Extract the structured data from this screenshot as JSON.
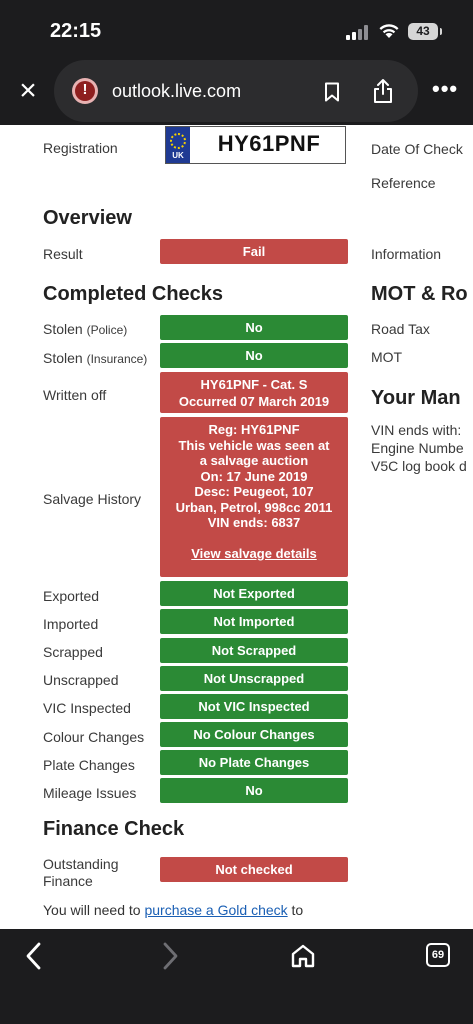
{
  "status": {
    "time": "22:15",
    "battery": "43"
  },
  "browser": {
    "url": "outlook.live.com",
    "tab_count": "69"
  },
  "vehicle": {
    "registration_label": "Registration",
    "plate": "HY61PNF",
    "plate_country": "UK",
    "date_of_check_label": "Date Of Check",
    "reference_label": "Reference"
  },
  "overview": {
    "heading": "Overview",
    "result_label": "Result",
    "result_value": "Fail",
    "information_label": "Information"
  },
  "completed_checks": {
    "heading": "Completed Checks",
    "stolen_police_label": "Stolen",
    "stolen_police_sub": "(Police)",
    "stolen_police_value": "No",
    "stolen_insurance_label": "Stolen",
    "stolen_insurance_sub": "(Insurance)",
    "stolen_insurance_value": "No",
    "written_off_label": "Written off",
    "written_off_line1": "HY61PNF - Cat. S",
    "written_off_line2": "Occurred 07 March 2019",
    "salvage_label": "Salvage History",
    "salvage_lines": [
      "Reg: HY61PNF",
      "This vehicle was seen at",
      "a salvage auction",
      "On: 17 June 2019",
      "Desc: Peugeot, 107",
      "Urban, Petrol, 998cc 2011",
      "VIN ends: 6837"
    ],
    "salvage_link": "View salvage details",
    "rows": [
      {
        "label": "Exported",
        "value": "Not Exported"
      },
      {
        "label": "Imported",
        "value": "Not Imported"
      },
      {
        "label": "Scrapped",
        "value": "Not Scrapped"
      },
      {
        "label": "Unscrapped",
        "value": "Not Unscrapped"
      },
      {
        "label": "VIC Inspected",
        "value": "Not VIC Inspected"
      },
      {
        "label": "Colour Changes",
        "value": "No Colour Changes"
      },
      {
        "label": "Plate Changes",
        "value": "No Plate Changes"
      },
      {
        "label": "Mileage Issues",
        "value": "No"
      }
    ]
  },
  "right_column": {
    "mot_heading": "MOT & Ro",
    "road_tax_label": "Road Tax",
    "mot_label": "MOT",
    "manual_heading": "Your Man",
    "vin_text": "VIN ends with:",
    "engine_text": "Engine Numbe",
    "v5c_text": "V5C log book d"
  },
  "finance": {
    "heading": "Finance Check",
    "outstanding_label_1": "Outstanding",
    "outstanding_label_2": "Finance",
    "outstanding_value": "Not checked",
    "note_prefix": "You will need to ",
    "note_link": "purchase a Gold check",
    "note_suffix": " to"
  },
  "colors": {
    "pass": "#2b8a35",
    "fail": "#c24a47",
    "link": "#1a5fb4"
  }
}
